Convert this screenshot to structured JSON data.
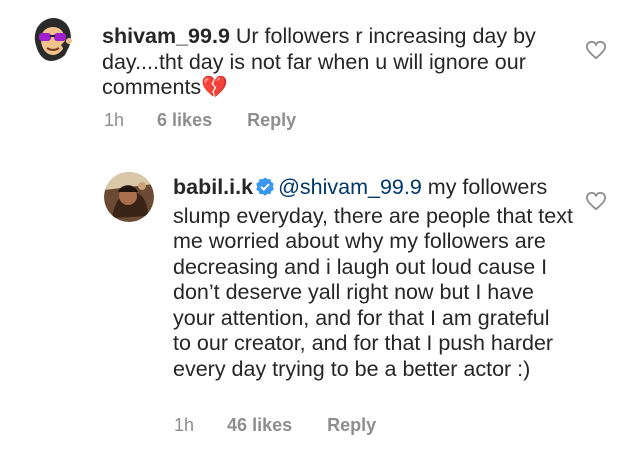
{
  "comment1": {
    "username": "shivam_99.9",
    "text": "Ur followers r increasing day by day....tht day is not far when u will ignore our comments",
    "emoji": "💔",
    "time": "1h",
    "likes": "6 likes",
    "reply_label": "Reply"
  },
  "comment2": {
    "username": "babil.i.k",
    "mention": "@shivam_99.9",
    "text": "my followers slump everyday, there are people that text me worried about why my followers are decreasing and i laugh out loud cause I don’t deserve yall right now but I have your attention, and for that I am grateful to our creator, and for that I push harder every day trying to be a better actor :)",
    "time": "1h",
    "likes": "46 likes",
    "reply_label": "Reply"
  },
  "colors": {
    "text": "#262626",
    "meta": "#8e8e8e",
    "mention": "#00376b",
    "verified": "#3897f0"
  }
}
